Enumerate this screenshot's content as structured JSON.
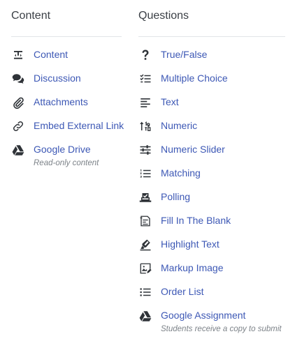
{
  "content": {
    "title": "Content",
    "items": [
      {
        "label": "Content",
        "icon": "text-format-icon"
      },
      {
        "label": "Discussion",
        "icon": "chat-bubbles-icon"
      },
      {
        "label": "Attachments",
        "icon": "paperclip-icon"
      },
      {
        "label": "Embed External Link",
        "icon": "link-icon"
      },
      {
        "label": "Google Drive",
        "icon": "google-drive-icon",
        "sublabel": "Read-only content"
      }
    ]
  },
  "questions": {
    "title": "Questions",
    "items": [
      {
        "label": "True/False",
        "icon": "question-mark-icon"
      },
      {
        "label": "Multiple Choice",
        "icon": "checklist-icon"
      },
      {
        "label": "Text",
        "icon": "text-lines-icon"
      },
      {
        "label": "Numeric",
        "icon": "numeric-sort-icon"
      },
      {
        "label": "Numeric Slider",
        "icon": "slider-icon"
      },
      {
        "label": "Matching",
        "icon": "numbered-list-icon"
      },
      {
        "label": "Polling",
        "icon": "ballot-box-icon"
      },
      {
        "label": "Fill In The Blank",
        "icon": "fill-blank-document-icon"
      },
      {
        "label": "Highlight Text",
        "icon": "highlighter-icon"
      },
      {
        "label": "Markup Image",
        "icon": "image-edit-icon"
      },
      {
        "label": "Order List",
        "icon": "bulleted-list-icon"
      },
      {
        "label": "Google Assignment",
        "icon": "google-drive-icon",
        "sublabel": "Students receive a copy to submit"
      }
    ]
  }
}
